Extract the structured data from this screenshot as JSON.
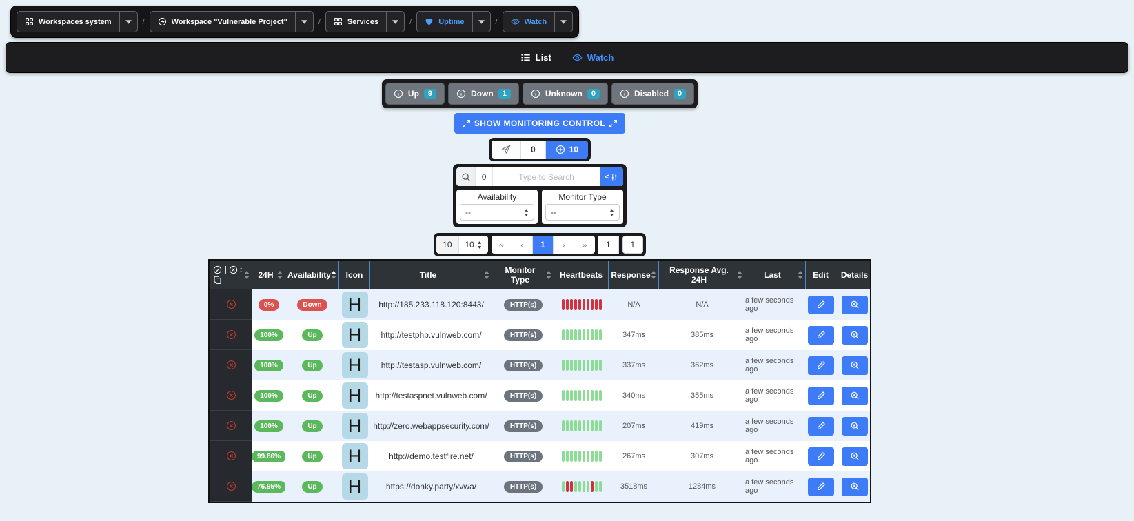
{
  "colors": {
    "accent_blue": "#3d7bf7",
    "link_blue": "#3f8fff",
    "teal_badge": "#2ea3bf",
    "up_green": "#5cb85c",
    "down_red": "#d9534f",
    "beat_green": "#8bdc95",
    "beat_red": "#d2323e",
    "dark_panel": "#1b1b1d",
    "header_bg": "#2e3338"
  },
  "breadcrumb": {
    "separator": "/",
    "items": [
      {
        "icon": "grid",
        "label": "Workspaces system",
        "accent": false
      },
      {
        "icon": "arrow-circle-right",
        "label": "Workspace \"Vulnerable Project\"",
        "accent": false
      },
      {
        "icon": "grid",
        "label": "Services",
        "accent": false
      },
      {
        "icon": "heart",
        "label": "Uptime",
        "accent": true
      },
      {
        "icon": "eye",
        "label": "Watch",
        "accent": true
      }
    ]
  },
  "navbar": {
    "items": [
      {
        "icon": "list",
        "label": "List",
        "accent": false
      },
      {
        "icon": "eye",
        "label": "Watch",
        "accent": true
      }
    ]
  },
  "status_summary": [
    {
      "label": "Up",
      "count": "9"
    },
    {
      "label": "Down",
      "count": "1"
    },
    {
      "label": "Unknown",
      "count": "0"
    },
    {
      "label": "Disabled",
      "count": "0"
    }
  ],
  "monitoring_control": {
    "label": "SHOW MONITORING CONTROL"
  },
  "counter_group": {
    "send_count": "0",
    "add_count": "10"
  },
  "search": {
    "count": "0",
    "placeholder": "Type to Search"
  },
  "filters": [
    {
      "title": "Availability",
      "value": "--"
    },
    {
      "title": "Monitor Type",
      "value": "--"
    }
  ],
  "pagination": {
    "rows_label": "10",
    "page_size": "10",
    "nav": [
      "«",
      "‹",
      "1",
      "›",
      "»"
    ],
    "active_index": 2,
    "current_page": "1",
    "total_pages": "1"
  },
  "table": {
    "columns": [
      {
        "label": "",
        "key": "select",
        "sort": "plain"
      },
      {
        "label": "24H",
        "sort": "plain"
      },
      {
        "label": "Availability",
        "sort": "asc"
      },
      {
        "label": "Icon",
        "sort": "none"
      },
      {
        "label": "Title",
        "sort": "plain"
      },
      {
        "label": "Monitor Type",
        "sort": "plain"
      },
      {
        "label": "Heartbeats",
        "sort": "none"
      },
      {
        "label": "Response",
        "sort": "plain"
      },
      {
        "label": "Response Avg. 24H",
        "sort": "plain"
      },
      {
        "label": "Last",
        "sort": "plain"
      },
      {
        "label": "Edit",
        "sort": "none"
      },
      {
        "label": "Details",
        "sort": "none"
      }
    ],
    "rows": [
      {
        "h24": "0%",
        "status": "Down",
        "state": "down",
        "icon_letter": "H",
        "title": "http://185.233.118.120:8443/",
        "monitor_type": "HTTP(s)",
        "beats": [
          "d",
          "d",
          "d",
          "d",
          "d",
          "d",
          "d",
          "d",
          "d",
          "d"
        ],
        "response": "N/A",
        "avg": "N/A",
        "last": "a few seconds ago"
      },
      {
        "h24": "100%",
        "status": "Up",
        "state": "up",
        "icon_letter": "H",
        "title": "http://testphp.vulnweb.com/",
        "monitor_type": "HTTP(s)",
        "beats": [
          "u",
          "u",
          "u",
          "u",
          "u",
          "u",
          "u",
          "u",
          "u",
          "u"
        ],
        "response": "347ms",
        "avg": "385ms",
        "last": "a few seconds ago"
      },
      {
        "h24": "100%",
        "status": "Up",
        "state": "up",
        "icon_letter": "H",
        "title": "http://testasp.vulnweb.com/",
        "monitor_type": "HTTP(s)",
        "beats": [
          "u",
          "u",
          "u",
          "u",
          "u",
          "u",
          "u",
          "u",
          "u",
          "u"
        ],
        "response": "337ms",
        "avg": "362ms",
        "last": "a few seconds ago"
      },
      {
        "h24": "100%",
        "status": "Up",
        "state": "up",
        "icon_letter": "H",
        "title": "http://testaspnet.vulnweb.com/",
        "monitor_type": "HTTP(s)",
        "beats": [
          "u",
          "u",
          "u",
          "u",
          "u",
          "u",
          "u",
          "u",
          "u",
          "u"
        ],
        "response": "340ms",
        "avg": "355ms",
        "last": "a few seconds ago"
      },
      {
        "h24": "100%",
        "status": "Up",
        "state": "up",
        "icon_letter": "H",
        "title": "http://zero.webappsecurity.com/",
        "monitor_type": "HTTP(s)",
        "beats": [
          "u",
          "u",
          "u",
          "u",
          "u",
          "u",
          "u",
          "u",
          "u",
          "u"
        ],
        "response": "207ms",
        "avg": "419ms",
        "last": "a few seconds ago"
      },
      {
        "h24": "99.86%",
        "status": "Up",
        "state": "up",
        "icon_letter": "H",
        "title": "http://demo.testfire.net/",
        "monitor_type": "HTTP(s)",
        "beats": [
          "u",
          "u",
          "u",
          "u",
          "u",
          "u",
          "u",
          "u",
          "u",
          "u"
        ],
        "response": "267ms",
        "avg": "307ms",
        "last": "a few seconds ago"
      },
      {
        "h24": "76.95%",
        "status": "Up",
        "state": "up",
        "icon_letter": "H",
        "title": "https://donky.party/xvwa/",
        "monitor_type": "HTTP(s)",
        "beats": [
          "u",
          "d",
          "d",
          "u",
          "u",
          "u",
          "u",
          "d",
          "u",
          "u"
        ],
        "response": "3518ms",
        "avg": "1284ms",
        "last": "a few seconds ago"
      }
    ]
  }
}
